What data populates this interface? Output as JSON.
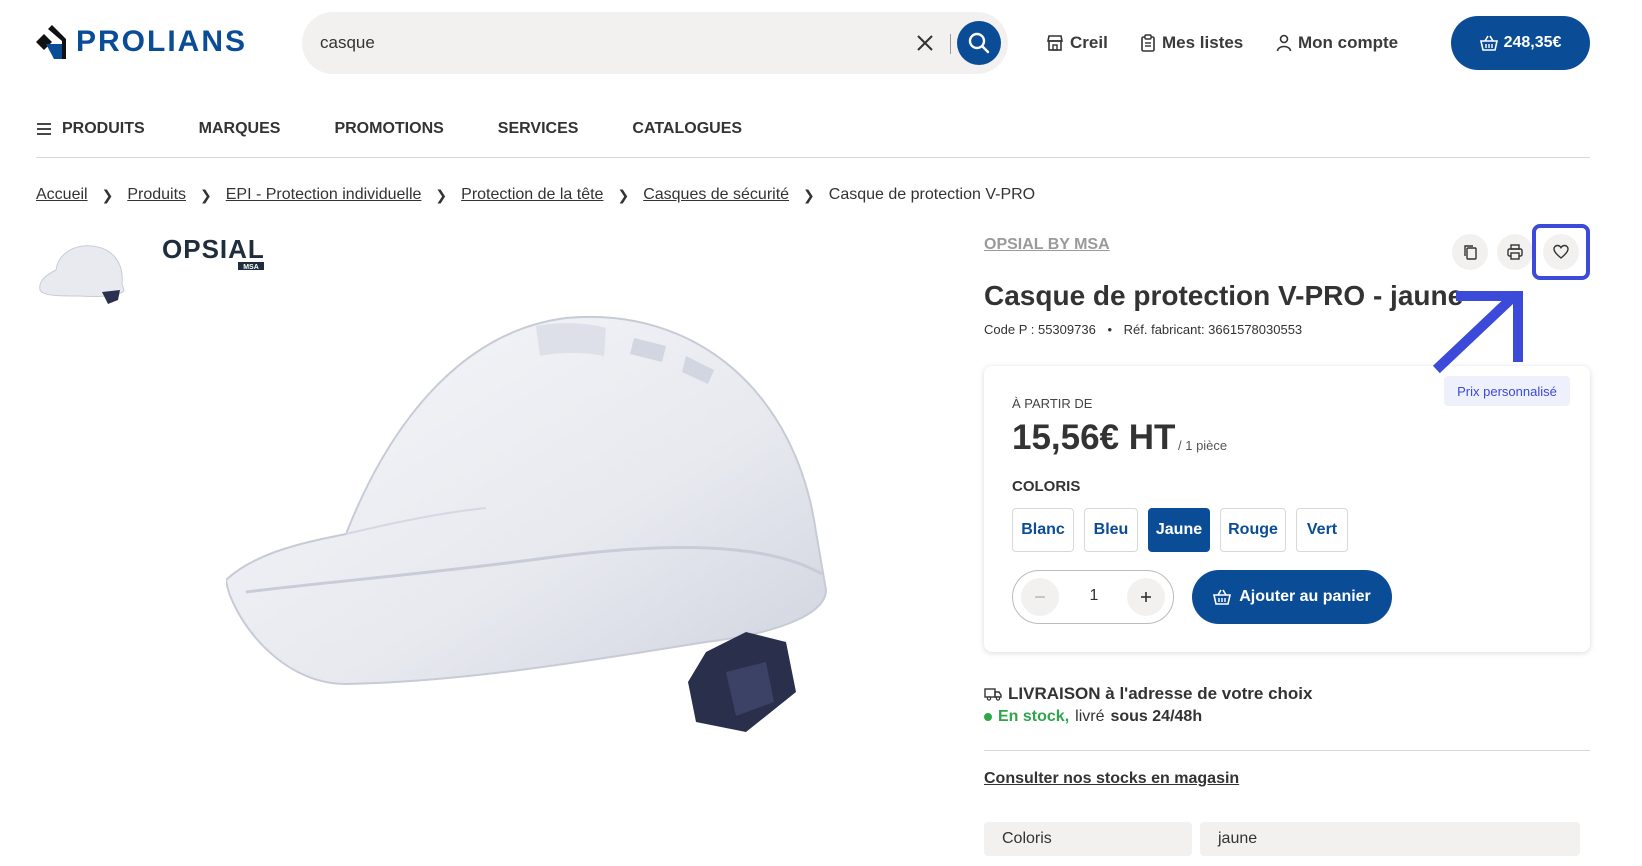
{
  "header": {
    "logo_text": "PROLIANS",
    "search": {
      "value": "casque",
      "placeholder": ""
    },
    "store_label": "Creil",
    "lists_label": "Mes listes",
    "account_label": "Mon compte",
    "cart_total": "248,35€"
  },
  "nav": {
    "items": [
      {
        "label": "PRODUITS"
      },
      {
        "label": "MARQUES"
      },
      {
        "label": "PROMOTIONS"
      },
      {
        "label": "SERVICES"
      },
      {
        "label": "CATALOGUES"
      }
    ]
  },
  "breadcrumb": {
    "items": [
      {
        "label": "Accueil"
      },
      {
        "label": "Produits"
      },
      {
        "label": "EPI - Protection individuelle"
      },
      {
        "label": "Protection de la tête"
      },
      {
        "label": "Casques de sécurité"
      }
    ],
    "current": "Casque de protection V-PRO"
  },
  "gallery": {
    "brand_logo_text": "OPSIAL",
    "brand_logo_sub": "MSA"
  },
  "product": {
    "brand": "OPSIAL BY MSA",
    "title": "Casque de protection V-PRO - jaune",
    "code_label": "Code P : 55309736",
    "separator": "•",
    "ref_label": "Réf. fabricant: 3661578030553",
    "tooltip": "Prix personnalisé",
    "price_card": {
      "from_label": "À PARTIR DE",
      "price": "15,56€ HT",
      "unit": "/ 1 pièce",
      "colors_label": "COLORIS",
      "colors": [
        {
          "label": "Blanc",
          "selected": false
        },
        {
          "label": "Bleu",
          "selected": false
        },
        {
          "label": "Jaune",
          "selected": true
        },
        {
          "label": "Rouge",
          "selected": false
        },
        {
          "label": "Vert",
          "selected": false
        }
      ],
      "quantity": "1",
      "add_to_cart": "Ajouter au panier"
    },
    "delivery": {
      "title": "LIVRAISON à l'adresse de votre choix",
      "stock_status": "En stock,",
      "stock_middle": "livré",
      "stock_delay": "sous 24/48h"
    },
    "stores_link": "Consulter nos stocks en magasin",
    "specs": [
      {
        "name": "Coloris",
        "value": "jaune"
      }
    ]
  },
  "colors": {
    "brand_blue": "#0a4d96",
    "highlight": "#3b4ad8",
    "stock_green": "#2fa64a"
  }
}
